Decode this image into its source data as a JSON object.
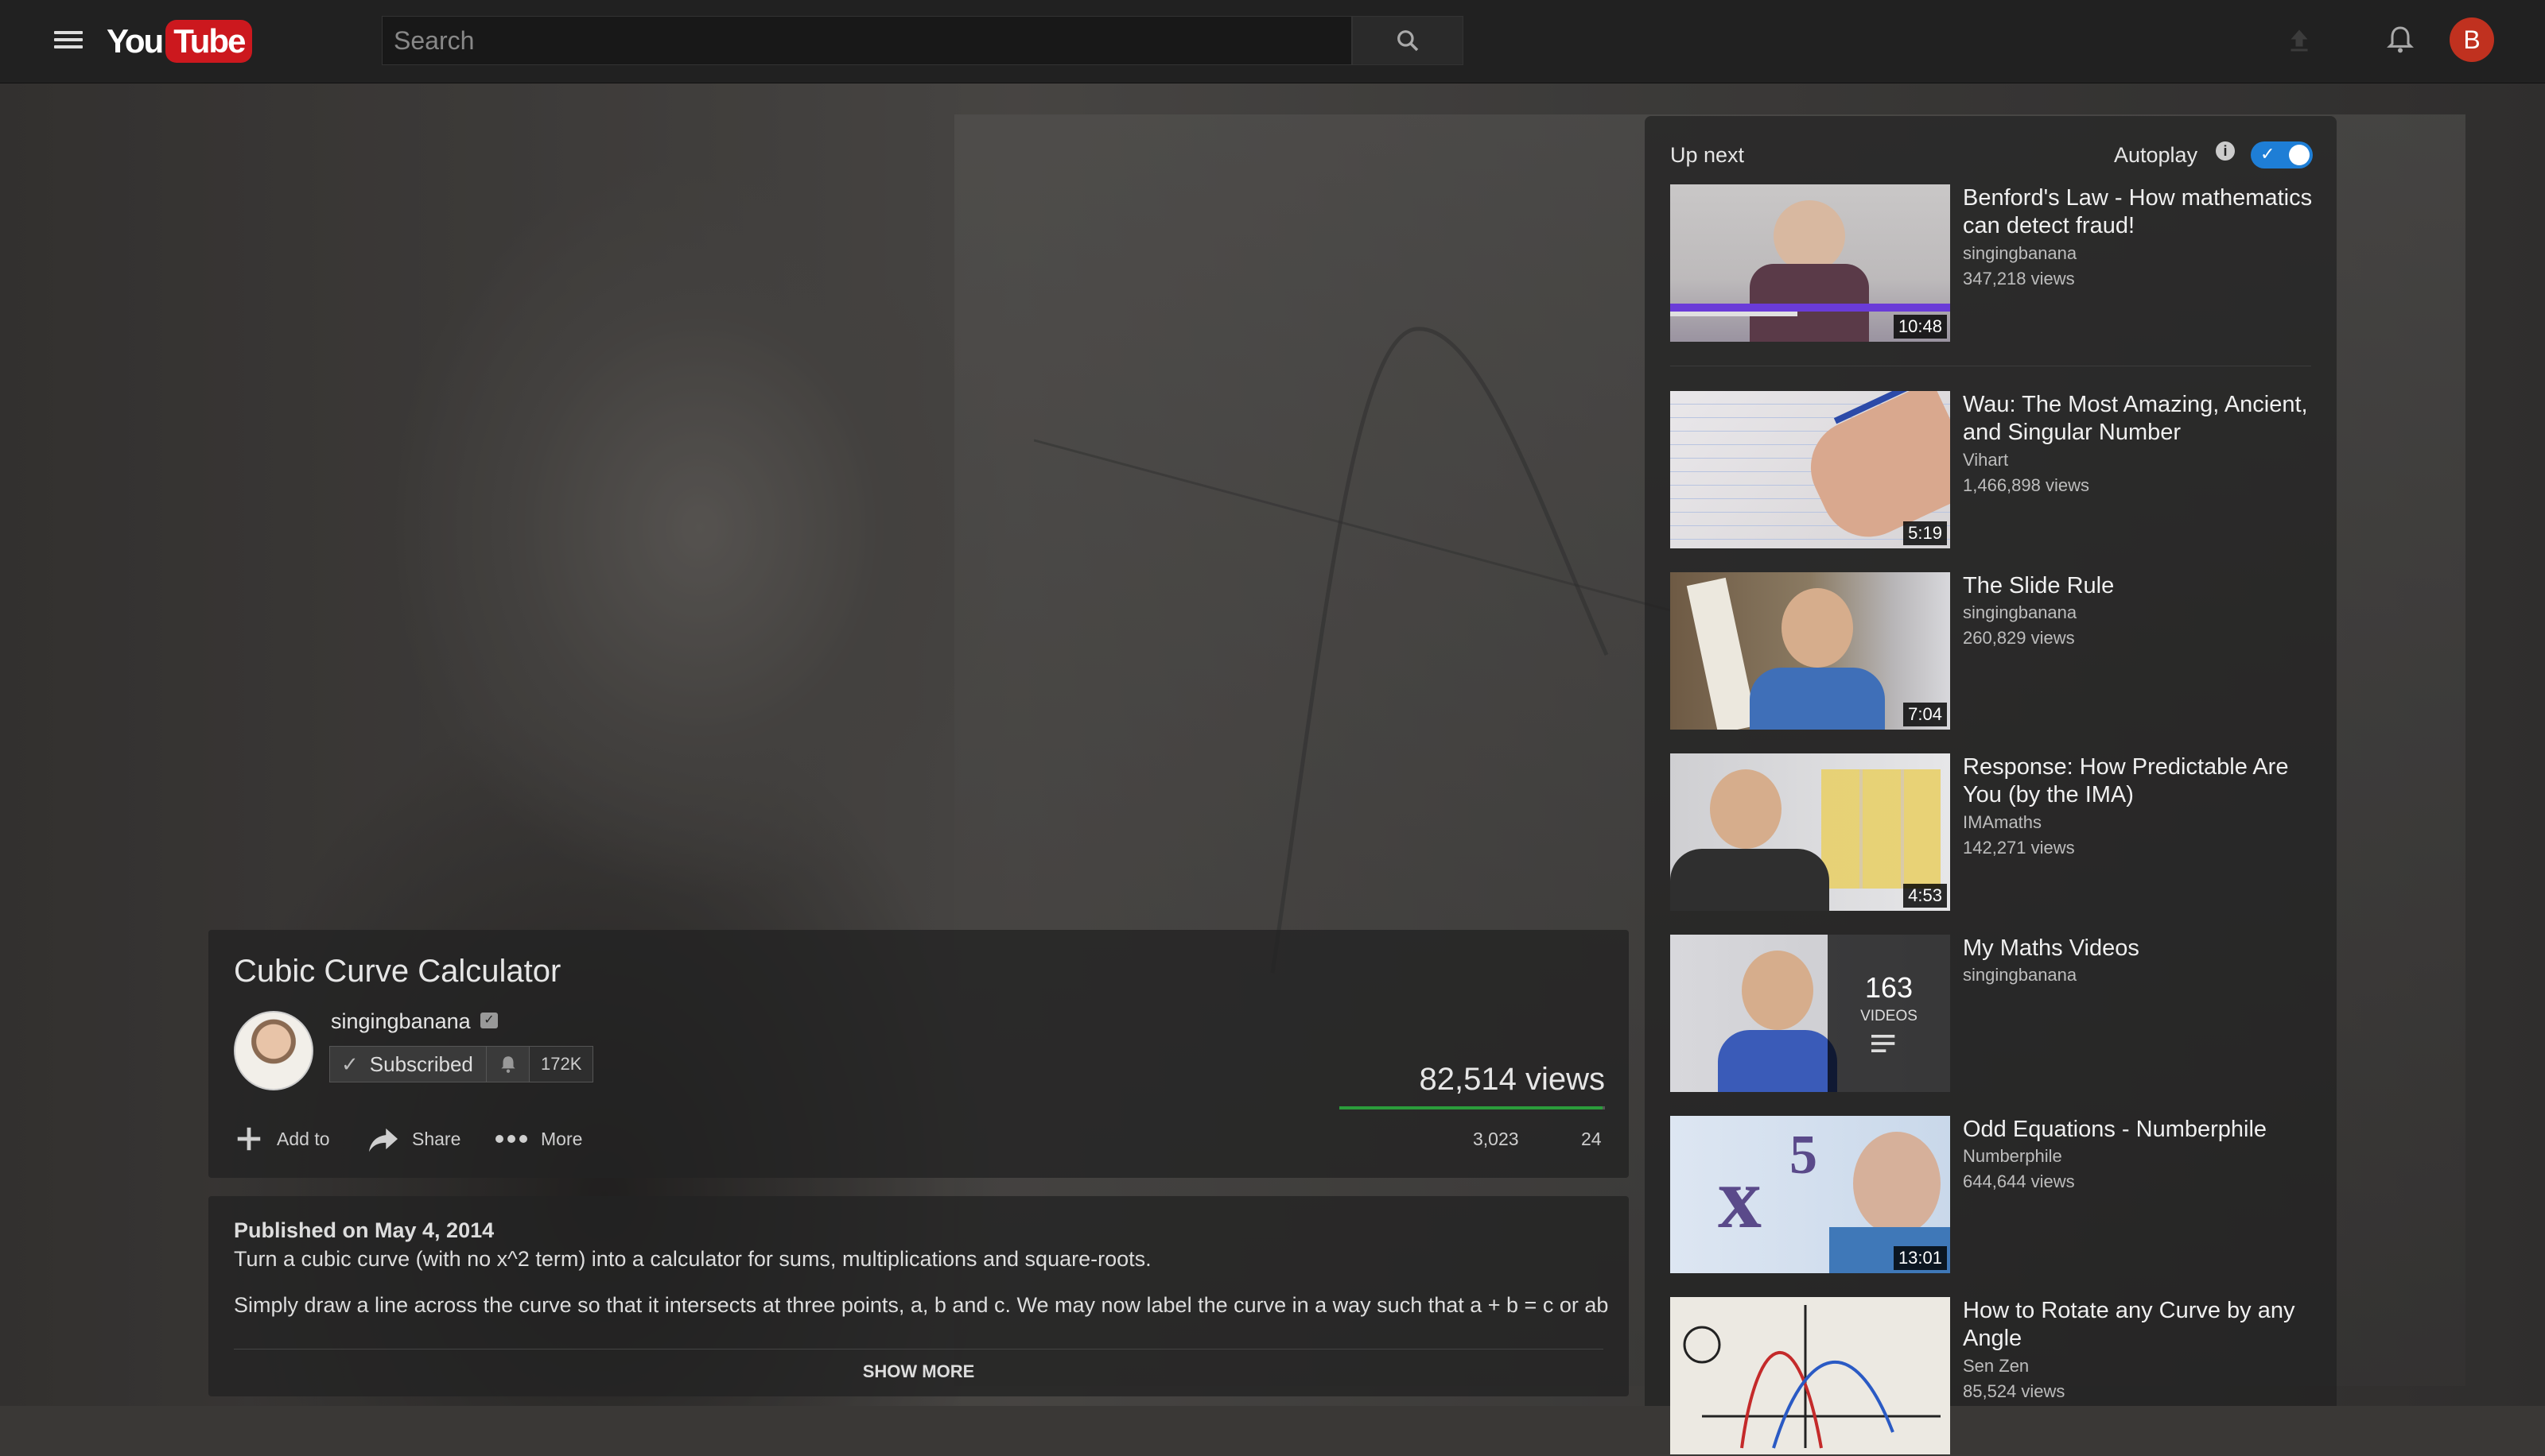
{
  "header": {
    "logo_you": "You",
    "logo_tube": "Tube",
    "search_placeholder": "Search",
    "avatar_letter": "B"
  },
  "video": {
    "title": "Cubic Curve Calculator",
    "channel": "singingbanana",
    "subscribe_label": "Subscribed",
    "subscriber_count": "172K",
    "views": "82,514 views",
    "likes": "3,023",
    "dislikes": "24",
    "like_ratio": 0.992,
    "actions": {
      "add_to": "Add to",
      "share": "Share",
      "more": "More"
    }
  },
  "description": {
    "published": "Published on May 4, 2014",
    "line1": "Turn a cubic curve (with no x^2 term) into a calculator for sums, multiplications and square-roots.",
    "line2": "Simply draw a line across the curve so that it intersects at three points, a, b and c. We may now label the curve in a way such that a + b = c or ab",
    "show_more": "SHOW MORE"
  },
  "sidebar": {
    "up_next": "Up next",
    "autoplay_label": "Autoplay",
    "autoplay_on": true,
    "recommendations": [
      {
        "title": "Benford's Law - How mathematics can detect fraud!",
        "channel": "singingbanana",
        "views": "347,218 views",
        "duration": "10:48"
      },
      {
        "title": "Wau: The Most Amazing, Ancient, and Singular Number",
        "channel": "Vihart",
        "views": "1,466,898 views",
        "duration": "5:19"
      },
      {
        "title": "The Slide Rule",
        "channel": "singingbanana",
        "views": "260,829 views",
        "duration": "7:04"
      },
      {
        "title": "Response: How Predictable Are You (by the IMA)",
        "channel": "IMAmaths",
        "views": "142,271 views",
        "duration": "4:53"
      },
      {
        "title": "My Maths Videos",
        "channel": "singingbanana",
        "playlist_count": "163",
        "playlist_label": "VIDEOS"
      },
      {
        "title": "Odd Equations - Numberphile",
        "channel": "Numberphile",
        "views": "644,644 views",
        "duration": "13:01"
      },
      {
        "title": "How to Rotate any Curve by any Angle",
        "channel": "Sen Zen",
        "views": "85,524 views"
      }
    ]
  }
}
